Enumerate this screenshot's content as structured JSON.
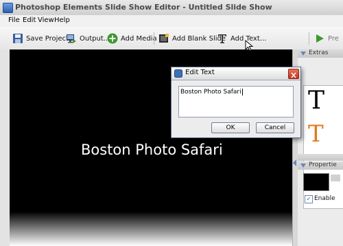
{
  "window": {
    "title": "Photoshop Elements Slide Show Editor - Untitled Slide Show"
  },
  "menu": {
    "items": [
      "File",
      "Edit",
      "View",
      "Help"
    ]
  },
  "toolbar": {
    "save_project": "Save Project...",
    "output": "Output...",
    "add_media": "Add Media",
    "add_blank_slide": "Add Blank Slide",
    "add_text": "Add Text...",
    "preview_partial": "Pre"
  },
  "stage": {
    "slide_text": "Boston Photo Safari"
  },
  "right_panel": {
    "extras_label": "Extras",
    "text_sample_1": "T",
    "text_sample_2": "T",
    "properties_label": "Propertie",
    "enable_label": "Enable"
  },
  "dialog": {
    "title": "Edit Text",
    "value": "Boston Photo Safari",
    "ok_label": "OK",
    "cancel_label": "Cancel"
  },
  "colors": {
    "accent_green": "#3a9a2a",
    "stage_bg": "#000000",
    "dialog_close_red": "#d8462f"
  }
}
